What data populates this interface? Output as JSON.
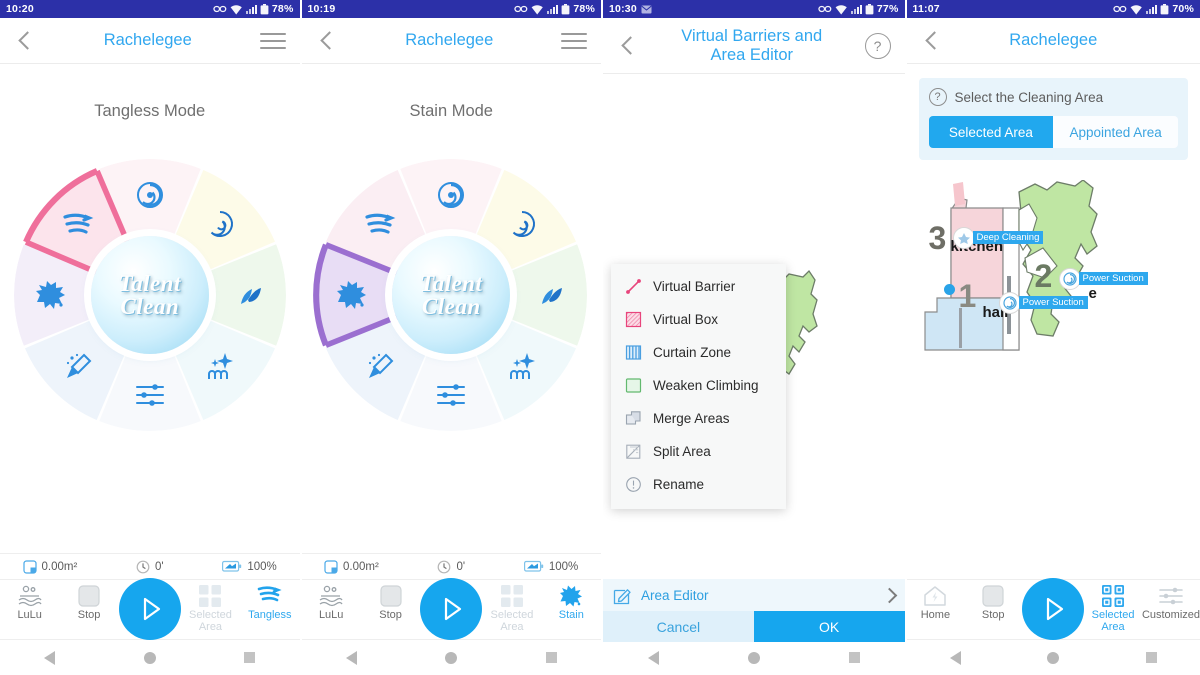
{
  "panels": [
    {
      "id": "tangless",
      "status": {
        "time": "10:20",
        "battery": "78%"
      },
      "header": {
        "title": "Rachelegee",
        "back_icon": "back-chevron-icon",
        "menu_icon": "hamburger-icon"
      },
      "mode_label": "Tangless Mode",
      "hub_line1": "Talent",
      "hub_line2": "Clean",
      "highlight_index": 7,
      "highlight_color": "#ef6f9b",
      "stats": [
        {
          "icon": "area-icon",
          "value": "0.00m²"
        },
        {
          "icon": "clock-icon",
          "value": "0'"
        },
        {
          "icon": "battery-icon",
          "value": "100%"
        }
      ],
      "actions": [
        {
          "label": "LuLu",
          "icon": "lulu-icon",
          "state": "normal"
        },
        {
          "label": "Stop",
          "icon": "stop-icon",
          "state": "normal"
        },
        {
          "label": "",
          "icon": "play-icon",
          "state": "play"
        },
        {
          "label": "Selected Area",
          "icon": "grid-icon",
          "state": "dim"
        },
        {
          "label": "Tangless",
          "icon": "tangless-icon",
          "state": "on"
        }
      ]
    },
    {
      "id": "stain",
      "status": {
        "time": "10:19",
        "battery": "78%"
      },
      "header": {
        "title": "Rachelegee",
        "back_icon": "back-chevron-icon",
        "menu_icon": "hamburger-icon"
      },
      "mode_label": "Stain Mode",
      "hub_line1": "Talent",
      "hub_line2": "Clean",
      "highlight_index": 6,
      "highlight_color": "#9b6fd0",
      "stats": [
        {
          "icon": "area-icon",
          "value": "0.00m²"
        },
        {
          "icon": "clock-icon",
          "value": "0'"
        },
        {
          "icon": "battery-icon",
          "value": "100%"
        }
      ],
      "actions": [
        {
          "label": "LuLu",
          "icon": "lulu-icon",
          "state": "normal"
        },
        {
          "label": "Stop",
          "icon": "stop-icon",
          "state": "normal"
        },
        {
          "label": "",
          "icon": "play-icon",
          "state": "play"
        },
        {
          "label": "Selected Area",
          "icon": "grid-icon",
          "state": "dim"
        },
        {
          "label": "Stain",
          "icon": "stain-icon",
          "state": "on"
        }
      ]
    },
    {
      "id": "virtual-barriers",
      "status": {
        "time": "10:30",
        "battery": "77%"
      },
      "header": {
        "title_line1": "Virtual Barriers and",
        "title_line2": "Area Editor",
        "back_icon": "back-chevron-icon",
        "help_icon": "help-icon",
        "help_label": "?"
      },
      "menu_items": [
        {
          "label": "Virtual Barrier",
          "icon": "virtual-barrier-icon"
        },
        {
          "label": "Virtual Box",
          "icon": "virtual-box-icon"
        },
        {
          "label": "Curtain Zone",
          "icon": "curtain-zone-icon"
        },
        {
          "label": "Weaken Climbing",
          "icon": "weaken-climbing-icon"
        },
        {
          "label": "Merge Areas",
          "icon": "merge-areas-icon"
        },
        {
          "label": "Split Area",
          "icon": "split-area-icon"
        },
        {
          "label": "Rename",
          "icon": "rename-icon"
        }
      ],
      "area_editor": {
        "label": "Area Editor",
        "icon": "edit-pencil-icon",
        "chevron": "chevron-right-icon"
      },
      "buttons": {
        "cancel": "Cancel",
        "ok": "OK"
      }
    },
    {
      "id": "select-area",
      "status": {
        "time": "11:07",
        "battery": "70%"
      },
      "header": {
        "title": "Rachelegee",
        "back_icon": "back-chevron-icon"
      },
      "select_card": {
        "help_label": "?",
        "title": "Select the Cleaning Area",
        "tabs": [
          {
            "label": "Selected Area",
            "selected": true
          },
          {
            "label": "Appointed Area",
            "selected": false
          }
        ]
      },
      "map_rooms": [
        {
          "number": "3",
          "name": "kitchen"
        },
        {
          "number": "2",
          "name": "e"
        },
        {
          "number": "1",
          "name": "hall"
        }
      ],
      "map_pills": [
        {
          "label": "Deep Cleaning",
          "icon": "deep-cleaning-icon"
        },
        {
          "label": "Power Suction",
          "icon": "power-suction-icon"
        },
        {
          "label": "Power Suction",
          "icon": "power-suction-icon"
        }
      ],
      "actions": [
        {
          "label": "Home",
          "icon": "home-icon",
          "state": "normal"
        },
        {
          "label": "Stop",
          "icon": "stop-icon",
          "state": "normal"
        },
        {
          "label": "",
          "icon": "play-icon",
          "state": "play"
        },
        {
          "label": "Selected Area",
          "icon": "grid-icon",
          "state": "on"
        },
        {
          "label": "Customized",
          "icon": "customized-icon",
          "state": "normal"
        }
      ]
    }
  ],
  "navbar": {
    "back": "nav-back-icon",
    "home": "nav-home-icon",
    "recents": "nav-recents-icon"
  },
  "colors": {
    "statusbar": "#2c30a8",
    "accent": "#31a7ef",
    "play": "#16a6ee",
    "ok": "#16a6ee",
    "cancel_bg": "#dff0fa"
  }
}
